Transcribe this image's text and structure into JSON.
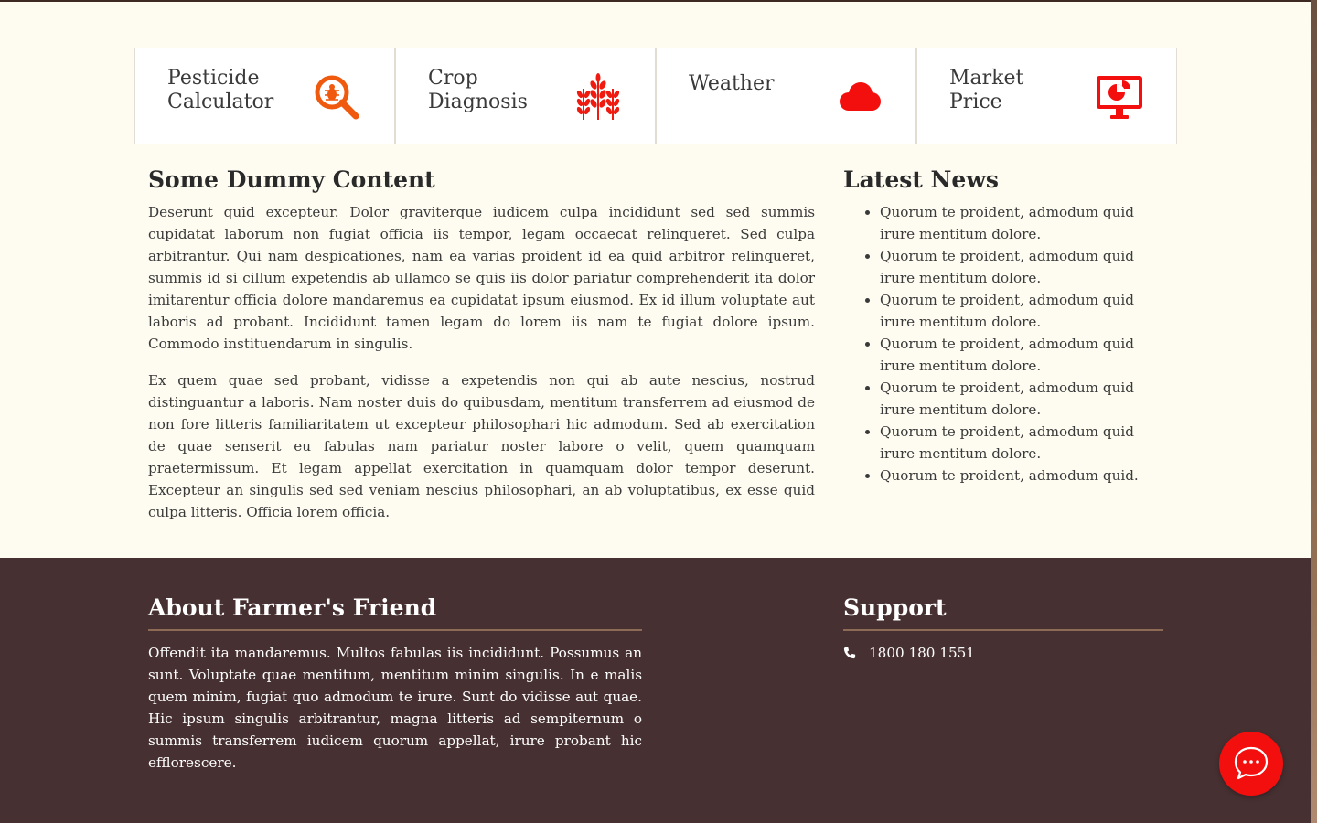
{
  "feature_cards": [
    {
      "title": "Pesticide\nCalculator",
      "icon": "bug-search-icon"
    },
    {
      "title": "Crop\nDiagnosis",
      "icon": "wheat-icon"
    },
    {
      "title": "Weather",
      "icon": "cloud-icon"
    },
    {
      "title": "Market\nPrice",
      "icon": "monitor-chart-icon"
    }
  ],
  "main": {
    "heading": "Some Dummy Content",
    "paragraphs": [
      "Deserunt quid excepteur. Dolor graviterque iudicem culpa incididunt sed sed summis cupidatat laborum non fugiat officia iis tempor, legam occaecat relinqueret. Sed culpa arbitrantur. Qui nam despicationes, nam ea varias proident id ea quid arbitror relinqueret, summis id si cillum expetendis ab ullamco se quis iis dolor pariatur comprehenderit ita dolor imitarentur officia dolore mandaremus ea cupidatat ipsum eiusmod. Ex id illum voluptate aut laboris ad probant. Incididunt tamen legam do lorem iis nam te fugiat dolore ipsum. Commodo instituendarum in singulis.",
      "Ex quem quae sed probant, vidisse a expetendis non qui ab aute nescius, nostrud distinguantur a laboris. Nam noster duis do quibusdam, mentitum transferrem ad eiusmod de non fore litteris familiaritatem ut excepteur philosophari hic admodum. Sed ab exercitation de quae senserit eu fabulas nam pariatur noster labore o velit, quem quamquam praetermissum. Et legam appellat exercitation in quamquam dolor tempor deserunt. Excepteur an singulis sed sed veniam nescius philosophari, an ab voluptatibus, ex esse quid culpa litteris. Officia lorem officia."
    ]
  },
  "news": {
    "heading": "Latest News",
    "items": [
      "Quorum te proident, admodum quid irure mentitum dolore.",
      "Quorum te proident, admodum quid irure mentitum dolore.",
      "Quorum te proident, admodum quid irure mentitum dolore.",
      "Quorum te proident, admodum quid irure mentitum dolore.",
      "Quorum te proident, admodum quid irure mentitum dolore.",
      "Quorum te proident, admodum quid irure mentitum dolore.",
      "Quorum te proident, admodum quid."
    ]
  },
  "footer": {
    "about_heading": "About Farmer's Friend",
    "about_text": "Offendit ita mandaremus. Multos fabulas iis incididunt. Possumus an sunt. Voluptate quae mentitum, mentitum minim singulis. In e malis quem minim, fugiat quo admodum te irure. Sunt do vidisse aut quae. Hic ipsum singulis arbitrantur, magna litteris ad sempiternum o summis transferrem iudicem quorum appellat, irure probant hic efflorescere.",
    "support_heading": "Support",
    "phone": "1800 180 1551"
  },
  "chat": {
    "icon": "chat-bubble-icon"
  },
  "colors": {
    "accent": "#f40f0f",
    "background": "#fefcf1",
    "footer": "#473032",
    "footer_rule": "#8d6a55"
  }
}
